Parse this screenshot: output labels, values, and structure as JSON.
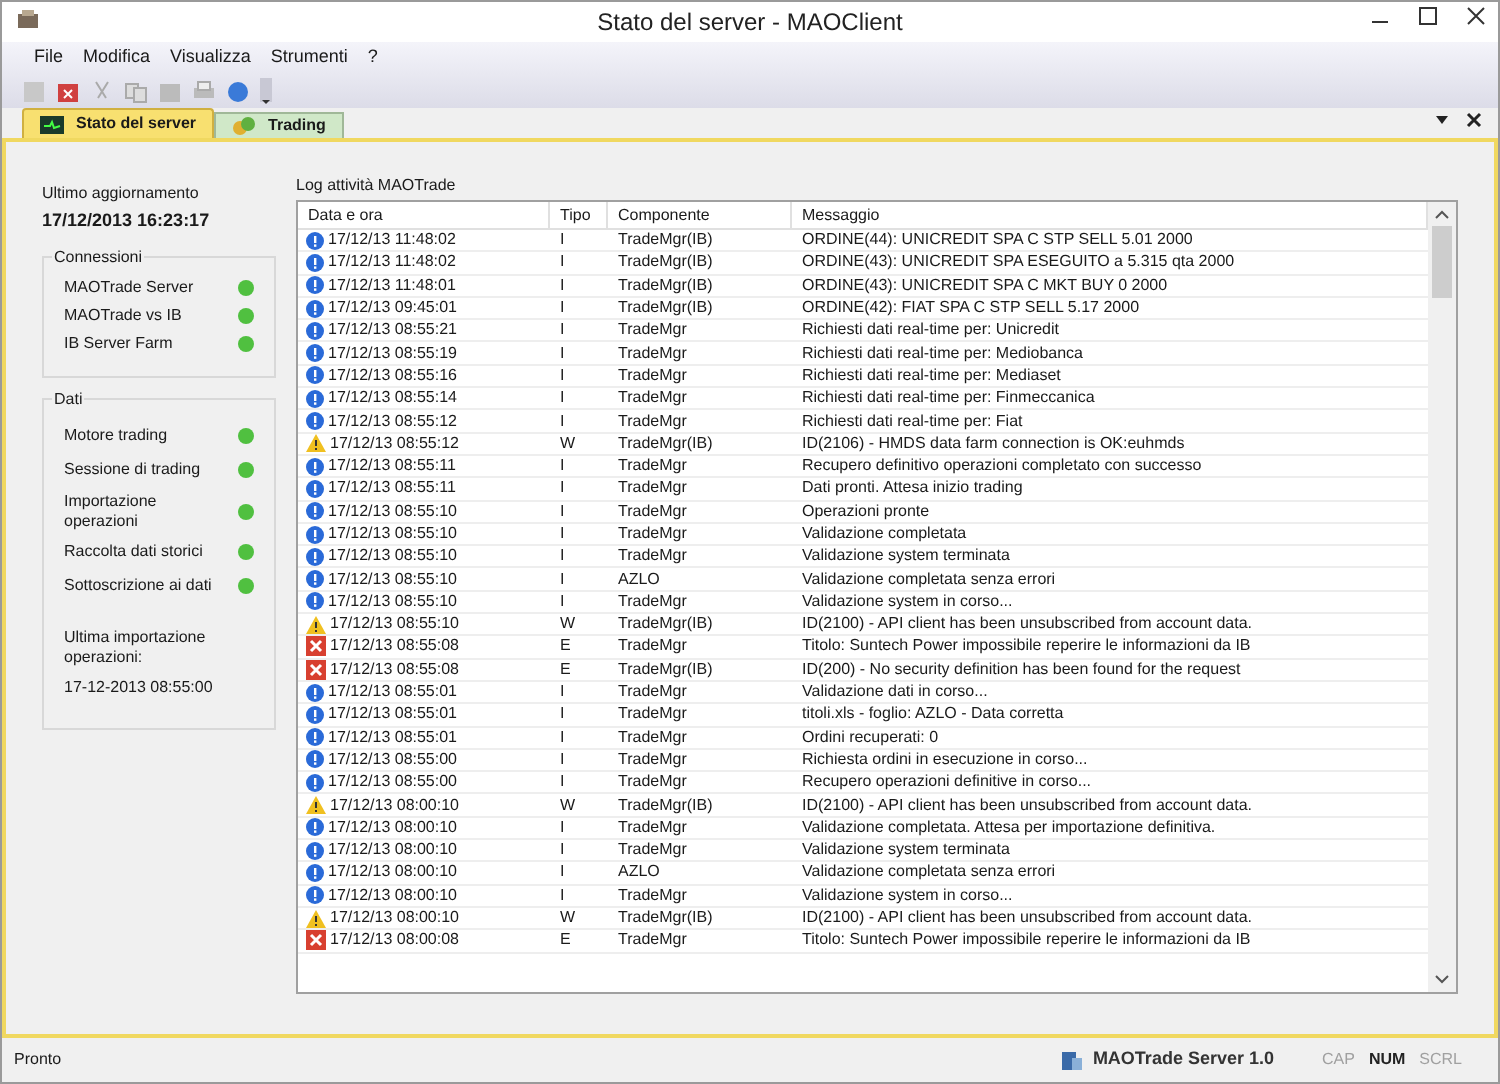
{
  "window": {
    "title": "Stato del server - MAOClient"
  },
  "menu": [
    "File",
    "Modifica",
    "Visualizza",
    "Strumenti",
    "?"
  ],
  "tabs": [
    {
      "label": "Stato del server",
      "selected": true
    },
    {
      "label": "Trading",
      "selected": false
    }
  ],
  "status_panel": {
    "last_update_label": "Ultimo aggiornamento",
    "last_update": "17/12/2013 16:23:17",
    "groups": [
      {
        "title": "Connessioni",
        "items": [
          {
            "label": "MAOTrade Server",
            "ok": true
          },
          {
            "label": "MAOTrade vs IB",
            "ok": true
          },
          {
            "label": "IB Server Farm",
            "ok": true
          }
        ]
      },
      {
        "title": "Dati",
        "items": [
          {
            "label": "Motore trading",
            "ok": true
          },
          {
            "label": "Sessione di trading",
            "ok": true
          },
          {
            "label": "Importazione operazioni",
            "ok": true
          },
          {
            "label": "Raccolta dati storici",
            "ok": true
          },
          {
            "label": "Sottoscrizione ai dati",
            "ok": true
          }
        ],
        "last_import_label": "Ultima importazione operazioni:",
        "last_import": "17-12-2013 08:55:00"
      }
    ]
  },
  "log": {
    "title": "Log attività MAOTrade",
    "columns": [
      "Data e ora",
      "Tipo",
      "Componente",
      "Messaggio"
    ],
    "rows": [
      {
        "time": "17/12/13 11:48:02",
        "type": "I",
        "component": "TradeMgr(IB)",
        "message": "ORDINE(44): UNICREDIT SPA C STP SELL 5.01 2000"
      },
      {
        "time": "17/12/13 11:48:02",
        "type": "I",
        "component": "TradeMgr(IB)",
        "message": "ORDINE(43): UNICREDIT SPA ESEGUITO a 5.315 qta 2000"
      },
      {
        "time": "17/12/13 11:48:01",
        "type": "I",
        "component": "TradeMgr(IB)",
        "message": "ORDINE(43): UNICREDIT SPA C MKT BUY 0 2000"
      },
      {
        "time": "17/12/13 09:45:01",
        "type": "I",
        "component": "TradeMgr(IB)",
        "message": "ORDINE(42): FIAT SPA C STP SELL 5.17 2000"
      },
      {
        "time": "17/12/13 08:55:21",
        "type": "I",
        "component": "TradeMgr",
        "message": "Richiesti dati real-time per: Unicredit"
      },
      {
        "time": "17/12/13 08:55:19",
        "type": "I",
        "component": "TradeMgr",
        "message": "Richiesti dati real-time per: Mediobanca"
      },
      {
        "time": "17/12/13 08:55:16",
        "type": "I",
        "component": "TradeMgr",
        "message": "Richiesti dati real-time per: Mediaset"
      },
      {
        "time": "17/12/13 08:55:14",
        "type": "I",
        "component": "TradeMgr",
        "message": "Richiesti dati real-time per: Finmeccanica"
      },
      {
        "time": "17/12/13 08:55:12",
        "type": "I",
        "component": "TradeMgr",
        "message": "Richiesti dati real-time per: Fiat"
      },
      {
        "time": "17/12/13 08:55:12",
        "type": "W",
        "component": "TradeMgr(IB)",
        "message": "ID(2106) - HMDS data farm connection is OK:euhmds"
      },
      {
        "time": "17/12/13 08:55:11",
        "type": "I",
        "component": "TradeMgr",
        "message": "Recupero definitivo operazioni completato con successo"
      },
      {
        "time": "17/12/13 08:55:11",
        "type": "I",
        "component": "TradeMgr",
        "message": "Dati pronti. Attesa inizio trading"
      },
      {
        "time": "17/12/13 08:55:10",
        "type": "I",
        "component": "TradeMgr",
        "message": "Operazioni pronte"
      },
      {
        "time": "17/12/13 08:55:10",
        "type": "I",
        "component": "TradeMgr",
        "message": "Validazione completata"
      },
      {
        "time": "17/12/13 08:55:10",
        "type": "I",
        "component": "TradeMgr",
        "message": "Validazione system terminata"
      },
      {
        "time": "17/12/13 08:55:10",
        "type": "I",
        "component": "AZLO",
        "message": "Validazione completata senza errori"
      },
      {
        "time": "17/12/13 08:55:10",
        "type": "I",
        "component": "TradeMgr",
        "message": "Validazione system in corso..."
      },
      {
        "time": "17/12/13 08:55:10",
        "type": "W",
        "component": "TradeMgr(IB)",
        "message": "ID(2100) - API client has been unsubscribed from account data."
      },
      {
        "time": "17/12/13 08:55:08",
        "type": "E",
        "component": "TradeMgr",
        "message": "Titolo: Suntech Power impossibile reperire le informazioni da IB"
      },
      {
        "time": "17/12/13 08:55:08",
        "type": "E",
        "component": "TradeMgr(IB)",
        "message": "ID(200) - No security definition has been found for the request"
      },
      {
        "time": "17/12/13 08:55:01",
        "type": "I",
        "component": "TradeMgr",
        "message": "Validazione dati in corso..."
      },
      {
        "time": "17/12/13 08:55:01",
        "type": "I",
        "component": "TradeMgr",
        "message": "titoli.xls - foglio: AZLO - Data corretta"
      },
      {
        "time": "17/12/13 08:55:01",
        "type": "I",
        "component": "TradeMgr",
        "message": "Ordini recuperati: 0"
      },
      {
        "time": "17/12/13 08:55:00",
        "type": "I",
        "component": "TradeMgr",
        "message": "Richiesta ordini in esecuzione in corso..."
      },
      {
        "time": "17/12/13 08:55:00",
        "type": "I",
        "component": "TradeMgr",
        "message": "Recupero operazioni definitive in corso..."
      },
      {
        "time": "17/12/13 08:00:10",
        "type": "W",
        "component": "TradeMgr(IB)",
        "message": "ID(2100) - API client has been unsubscribed from account data."
      },
      {
        "time": "17/12/13 08:00:10",
        "type": "I",
        "component": "TradeMgr",
        "message": "Validazione completata. Attesa per importazione definitiva."
      },
      {
        "time": "17/12/13 08:00:10",
        "type": "I",
        "component": "TradeMgr",
        "message": "Validazione system terminata"
      },
      {
        "time": "17/12/13 08:00:10",
        "type": "I",
        "component": "AZLO",
        "message": "Validazione completata senza errori"
      },
      {
        "time": "17/12/13 08:00:10",
        "type": "I",
        "component": "TradeMgr",
        "message": "Validazione system in corso..."
      },
      {
        "time": "17/12/13 08:00:10",
        "type": "W",
        "component": "TradeMgr(IB)",
        "message": "ID(2100) - API client has been unsubscribed from account data."
      },
      {
        "time": "17/12/13 08:00:08",
        "type": "E",
        "component": "TradeMgr",
        "message": "Titolo: Suntech Power impossibile reperire le informazioni da IB"
      }
    ]
  },
  "status_bar": {
    "message": "Pronto",
    "server": "MAOTrade Server 1.0",
    "indicators": [
      {
        "label": "CAP",
        "on": false
      },
      {
        "label": "NUM",
        "on": true
      },
      {
        "label": "SCRL",
        "on": false
      }
    ]
  }
}
